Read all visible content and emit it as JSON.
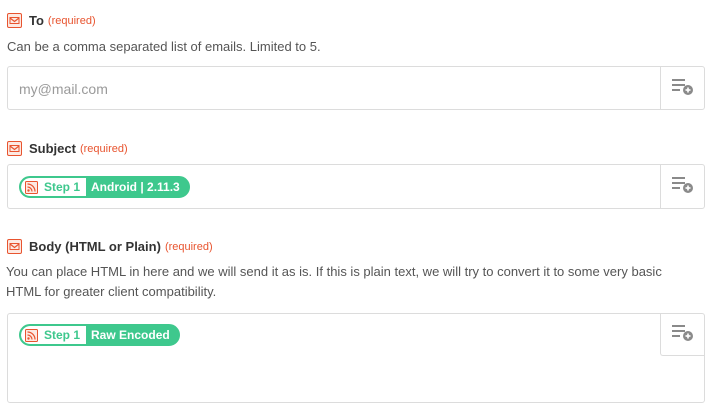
{
  "to": {
    "label": "To",
    "required": "(required)",
    "help": "Can be a comma separated list of emails. Limited to 5.",
    "placeholder": "my@mail.com"
  },
  "subject": {
    "label": "Subject",
    "required": "(required)",
    "pill": {
      "step": "Step 1",
      "value": "Android | 2.11.3"
    }
  },
  "body": {
    "label": "Body (HTML or Plain)",
    "required": "(required)",
    "help": "You can place HTML in here and we will send it as is. If this is plain text, we will try to convert it to some very basic HTML for greater client compatibility.",
    "pill": {
      "step": "Step 1",
      "value": "Raw Encoded"
    }
  },
  "colors": {
    "accent_green": "#3ec88d",
    "required_red": "#e8542f",
    "icon_orange": "#e8542f"
  },
  "icons": {
    "field_icon": "mail-icon",
    "insert_button_icon": "insert-field-icon",
    "step_app_icon": "rss-app-icon"
  }
}
